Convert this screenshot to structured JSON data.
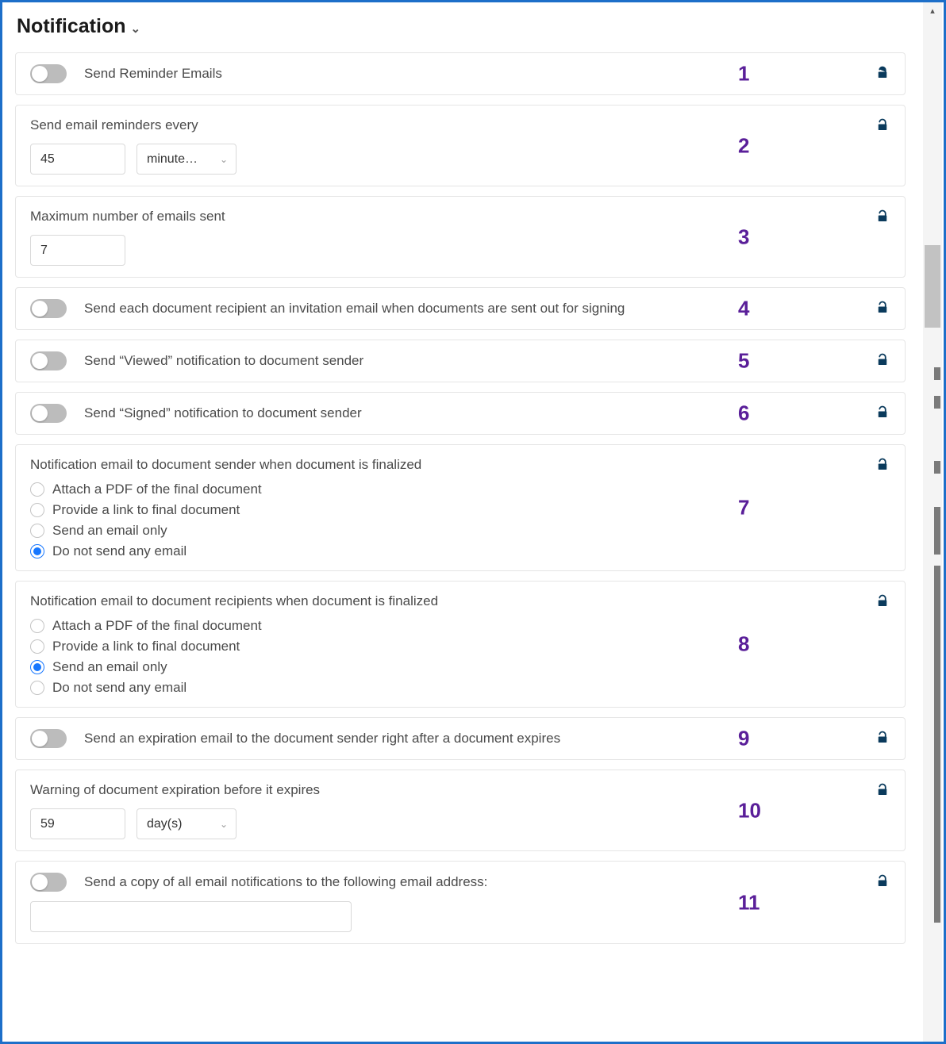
{
  "section": {
    "title": "Notification"
  },
  "cards": {
    "c1": {
      "num": "1",
      "label": "Send Reminder Emails"
    },
    "c2": {
      "num": "2",
      "label": "Send email reminders every",
      "value": "45",
      "unit": "minute…"
    },
    "c3": {
      "num": "3",
      "label": "Maximum number of emails sent",
      "value": "7"
    },
    "c4": {
      "num": "4",
      "label": "Send each document recipient an invitation email when documents are sent out for signing"
    },
    "c5": {
      "num": "5",
      "label": "Send “Viewed” notification to document sender"
    },
    "c6": {
      "num": "6",
      "label": "Send “Signed” notification to document sender"
    },
    "c7": {
      "num": "7",
      "label": "Notification email to document sender when document is finalized",
      "options": {
        "o1": "Attach a PDF of the final document",
        "o2": "Provide a link to final document",
        "o3": "Send an email only",
        "o4": "Do not send any email"
      },
      "selected": 3
    },
    "c8": {
      "num": "8",
      "label": "Notification email to document recipients when document is finalized",
      "options": {
        "o1": "Attach a PDF of the final document",
        "o2": "Provide a link to final document",
        "o3": "Send an email only",
        "o4": "Do not send any email"
      },
      "selected": 2
    },
    "c9": {
      "num": "9",
      "label": "Send an expiration email to the document sender right after a document expires"
    },
    "c10": {
      "num": "10",
      "label": "Warning of document expiration before it expires",
      "value": "59",
      "unit": "day(s)"
    },
    "c11": {
      "num": "11",
      "label": "Send a copy of all email notifications to the following email address:",
      "value": ""
    }
  }
}
